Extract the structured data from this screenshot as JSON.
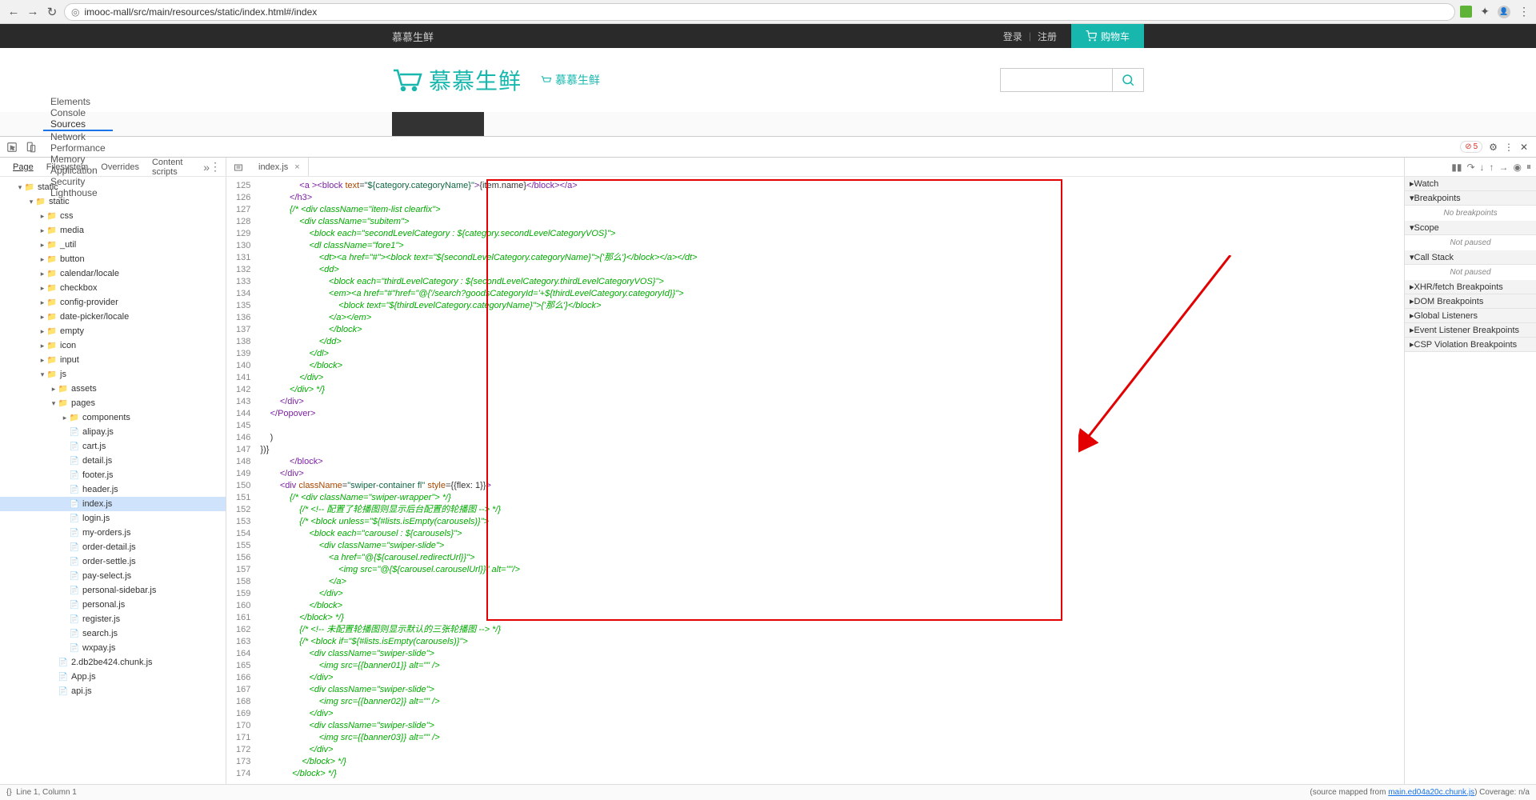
{
  "chrome": {
    "url": "imooc-mall/src/main/resources/static/index.html#/index"
  },
  "page": {
    "brand": "慕慕生鲜",
    "login": "登录",
    "register": "注册",
    "cart": "购物车",
    "logo_text": "慕慕生鲜",
    "small_logo": "慕慕生鲜"
  },
  "devtools": {
    "tabs": [
      "Elements",
      "Console",
      "Sources",
      "Network",
      "Performance",
      "Memory",
      "Application",
      "Security",
      "Lighthouse"
    ],
    "active_tab": "Sources",
    "error_count": "5",
    "sub_tabs": [
      "Page",
      "Filesystem",
      "Overrides",
      "Content scripts"
    ],
    "active_sub": "Page",
    "open_file": "index.js",
    "status_left": "Line 1, Column 1",
    "status_right_prefix": "(source mapped from ",
    "status_link": "main.ed04a20c.chunk.js",
    "status_right_suffix": ")  Coverage: n/a",
    "watch": "Watch",
    "breakpoints": "Breakpoints",
    "no_breakpoints": "No breakpoints",
    "scope": "Scope",
    "not_paused": "Not paused",
    "callstack": "Call Stack",
    "xhr": "XHR/fetch Breakpoints",
    "dom": "DOM Breakpoints",
    "global": "Global Listeners",
    "event": "Event Listener Breakpoints",
    "csp": "CSP Violation Breakpoints"
  },
  "tree": {
    "static1": "static",
    "static2": "static",
    "css": "css",
    "media": "media",
    "util": "_util",
    "button": "button",
    "calendar": "calendar/locale",
    "checkbox": "checkbox",
    "config": "config-provider",
    "date": "date-picker/locale",
    "empty": "empty",
    "icon": "icon",
    "input": "input",
    "js": "js",
    "assets": "assets",
    "pages": "pages",
    "components": "components",
    "alipay": "alipay.js",
    "cart": "cart.js",
    "detail": "detail.js",
    "footer": "footer.js",
    "header": "header.js",
    "index": "index.js",
    "login": "login.js",
    "myorders": "my-orders.js",
    "orderdetail": "order-detail.js",
    "ordersettle": "order-settle.js",
    "payselect": "pay-select.js",
    "personalsidebar": "personal-sidebar.js",
    "personal": "personal.js",
    "register": "register.js",
    "search": "search.js",
    "wxpay": "wxpay.js",
    "chunk": "2.db2be424.chunk.js",
    "app": "App.js",
    "api": "api.js"
  },
  "code": {
    "lines": [
      {
        "n": 125,
        "h": "                <span class='c-tag'>&lt;a &gt;&lt;block</span> <span class='c-a'>text</span>=<span class='c-s'>\"${category.categoryName}\"</span><span class='c-tag'>&gt;</span>{item.name}<span class='c-tag'>&lt;/block&gt;&lt;/a&gt;</span>"
      },
      {
        "n": 126,
        "h": "            <span class='c-tag'>&lt;/h3&gt;</span>"
      },
      {
        "n": 127,
        "h": "            <span class='c-cm'>{/* &lt;div className=\"item-list clearfix\"&gt;</span>"
      },
      {
        "n": 128,
        "h": "<span class='c-cm'>                &lt;div className=\"subitem\"&gt;</span>"
      },
      {
        "n": 129,
        "h": "<span class='c-cm'>                    &lt;block each=\"secondLevelCategory : ${category.secondLevelCategoryVOS}\"&gt;</span>"
      },
      {
        "n": 130,
        "h": "<span class='c-cm'>                    &lt;dl className=\"fore1\"&gt;</span>"
      },
      {
        "n": 131,
        "h": "<span class='c-cm'>                        &lt;dt&gt;&lt;a href=\"#\"&gt;&lt;block text=\"${secondLevelCategory.categoryName}\"&gt;{'那么'}&lt;/block&gt;&lt;/a&gt;&lt;/dt&gt;</span>"
      },
      {
        "n": 132,
        "h": "<span class='c-cm'>                        &lt;dd&gt;</span>"
      },
      {
        "n": 133,
        "h": "<span class='c-cm'>                            &lt;block each=\"thirdLevelCategory : ${secondLevelCategory.thirdLevelCategoryVOS}\"&gt;</span>"
      },
      {
        "n": 134,
        "h": "<span class='c-cm'>                            &lt;em&gt;&lt;a href=\"#\"href=\"@{'/search?goodsCategoryId='+${thirdLevelCategory.categoryId}}\"&gt;</span>"
      },
      {
        "n": 135,
        "h": "<span class='c-cm'>                                &lt;block text=\"${thirdLevelCategory.categoryName}\"&gt;{'那么'}&lt;/block&gt;</span>"
      },
      {
        "n": 136,
        "h": "<span class='c-cm'>                            &lt;/a&gt;&lt;/em&gt;</span>"
      },
      {
        "n": 137,
        "h": "<span class='c-cm'>                            &lt;/block&gt;</span>"
      },
      {
        "n": 138,
        "h": "<span class='c-cm'>                        &lt;/dd&gt;</span>"
      },
      {
        "n": 139,
        "h": "<span class='c-cm'>                    &lt;/dl&gt;</span>"
      },
      {
        "n": 140,
        "h": "<span class='c-cm'>                    &lt;/block&gt;</span>"
      },
      {
        "n": 141,
        "h": "<span class='c-cm'>                &lt;/div&gt;</span>"
      },
      {
        "n": 142,
        "h": "<span class='c-cm'>            &lt;/div&gt; */}</span>"
      },
      {
        "n": 143,
        "h": "        <span class='c-tag'>&lt;/div&gt;</span>"
      },
      {
        "n": 144,
        "h": "    <span class='c-tag'>&lt;/Popover&gt;</span>"
      },
      {
        "n": 145,
        "h": ""
      },
      {
        "n": 146,
        "h": "    )"
      },
      {
        "n": 147,
        "h": "})}"
      },
      {
        "n": 148,
        "h": "            <span class='c-tag'>&lt;/block&gt;</span>"
      },
      {
        "n": 149,
        "h": "        <span class='c-tag'>&lt;/div&gt;</span>"
      },
      {
        "n": 150,
        "h": "        <span class='c-tag'>&lt;div</span> <span class='c-a'>className</span>=<span class='c-s'>\"swiper-container fl\"</span> <span class='c-a'>style</span>={{flex: 1}}<span class='c-tag'>&gt;</span>"
      },
      {
        "n": 151,
        "h": "            <span class='c-cm'>{/* &lt;div className=\"swiper-wrapper\"&gt; */}</span>"
      },
      {
        "n": 152,
        "h": "                <span class='c-cm'>{/* &lt;!-- 配置了轮播图则显示后台配置的轮播图 --&gt; */}</span>"
      },
      {
        "n": 153,
        "h": "                <span class='c-cm'>{/* &lt;block unless=\"${#lists.isEmpty(carousels)}\"&gt;</span>"
      },
      {
        "n": 154,
        "h": "<span class='c-cm'>                    &lt;block each=\"carousel : ${carousels}\"&gt;</span>"
      },
      {
        "n": 155,
        "h": "<span class='c-cm'>                        &lt;div className=\"swiper-slide\"&gt;</span>"
      },
      {
        "n": 156,
        "h": "<span class='c-cm'>                            &lt;a href=\"@{${carousel.redirectUrl}}\"&gt;</span>"
      },
      {
        "n": 157,
        "h": "<span class='c-cm'>                                &lt;img src=\"@{${carousel.carouselUrl}}\" alt=\"\"/&gt;</span>"
      },
      {
        "n": 158,
        "h": "<span class='c-cm'>                            &lt;/a&gt;</span>"
      },
      {
        "n": 159,
        "h": "<span class='c-cm'>                        &lt;/div&gt;</span>"
      },
      {
        "n": 160,
        "h": "<span class='c-cm'>                    &lt;/block&gt;</span>"
      },
      {
        "n": 161,
        "h": "<span class='c-cm'>                &lt;/block&gt; */}</span>"
      },
      {
        "n": 162,
        "h": "                <span class='c-cm'>{/* &lt;!-- 未配置轮播图则显示默认的三张轮播图 --&gt; */}</span>"
      },
      {
        "n": 163,
        "h": "                <span class='c-cm'>{/* &lt;block if=\"${#lists.isEmpty(carousels)}\"&gt;</span>"
      },
      {
        "n": 164,
        "h": "<span class='c-cm'>                    &lt;div className=\"swiper-slide\"&gt;</span>"
      },
      {
        "n": 165,
        "h": "<span class='c-cm'>                        &lt;img src={{banner01}} alt=\"\" /&gt;</span>"
      },
      {
        "n": 166,
        "h": "<span class='c-cm'>                    &lt;/div&gt;</span>"
      },
      {
        "n": 167,
        "h": "<span class='c-cm'>                    &lt;div className=\"swiper-slide\"&gt;</span>"
      },
      {
        "n": 168,
        "h": "<span class='c-cm'>                        &lt;img src={{banner02}} alt=\"\" /&gt;</span>"
      },
      {
        "n": 169,
        "h": "<span class='c-cm'>                    &lt;/div&gt;</span>"
      },
      {
        "n": 170,
        "h": "<span class='c-cm'>                    &lt;div className=\"swiper-slide\"&gt;</span>"
      },
      {
        "n": 171,
        "h": "<span class='c-cm'>                        &lt;img src={{banner03}} alt=\"\" /&gt;</span>"
      },
      {
        "n": 172,
        "h": "<span class='c-cm'>                    &lt;/div&gt;</span>"
      },
      {
        "n": 173,
        "h": "<span class='c-cm'>                 &lt;/block&gt; */}</span>"
      },
      {
        "n": 174,
        "h": "<span class='c-cm'>             &lt;/block&gt; */}</span>"
      }
    ]
  }
}
